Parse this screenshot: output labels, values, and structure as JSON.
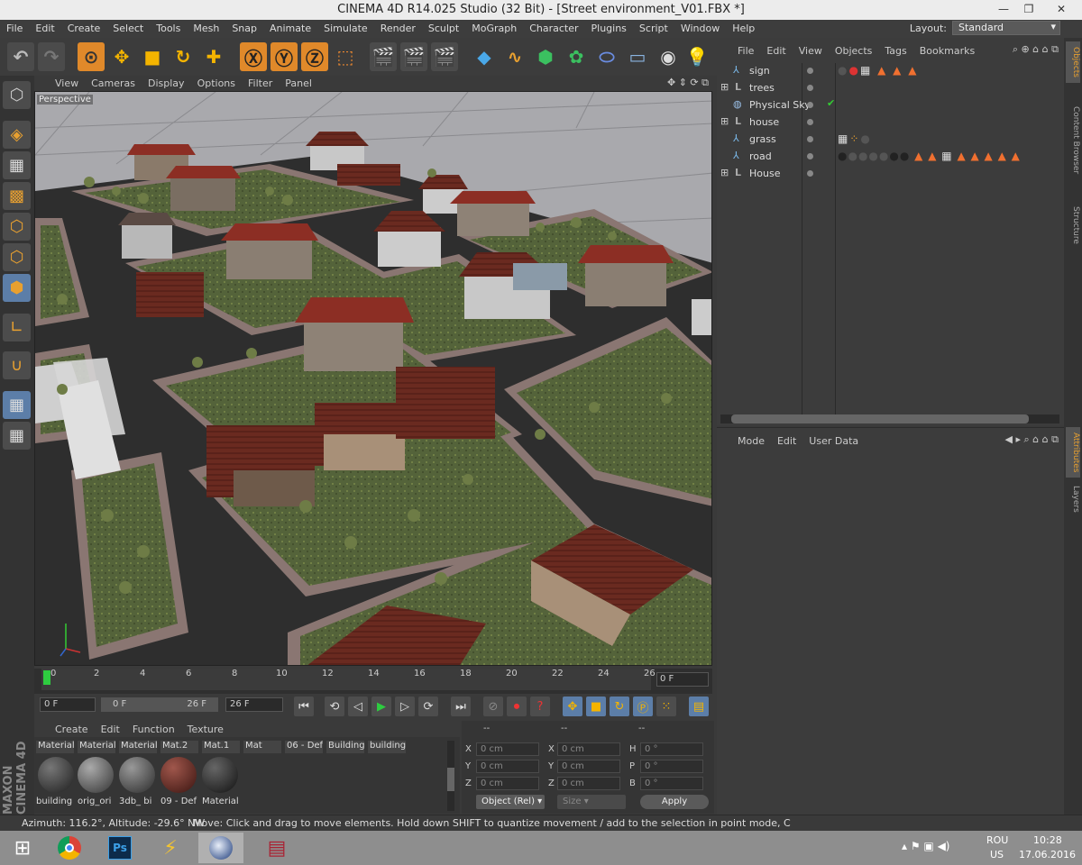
{
  "window": {
    "title": "CINEMA 4D R14.025 Studio (32 Bit) - [Street environment_V01.FBX *]",
    "minimize": "—",
    "restore": "❐",
    "close": "✕"
  },
  "menu": [
    "File",
    "Edit",
    "Create",
    "Select",
    "Tools",
    "Mesh",
    "Snap",
    "Animate",
    "Simulate",
    "Render",
    "Sculpt",
    "MoGraph",
    "Character",
    "Plugins",
    "Script",
    "Window",
    "Help"
  ],
  "layout": {
    "label": "Layout:",
    "value": "Standard"
  },
  "viewport": {
    "menu": [
      "View",
      "Cameras",
      "Display",
      "Options",
      "Filter",
      "Panel"
    ],
    "label": "Perspective"
  },
  "timeline": {
    "ticks": [
      "0",
      "2",
      "4",
      "6",
      "8",
      "10",
      "12",
      "14",
      "16",
      "18",
      "20",
      "22",
      "24",
      "26"
    ],
    "end_frame": "0 F"
  },
  "transport": {
    "current": "0 F",
    "range_start": "0 F",
    "range_end": "26 F",
    "max": "26 F"
  },
  "material_manager": {
    "menu": [
      "Create",
      "Edit",
      "Function",
      "Texture"
    ],
    "top_names": [
      "Material",
      "Material",
      "Material",
      "Mat.2",
      "Mat.1",
      "Mat",
      "06 - Def",
      "Building",
      "building"
    ],
    "materials": [
      {
        "label": "building",
        "color": "#333"
      },
      {
        "label": "orig_ori",
        "color": "#555"
      },
      {
        "label": "3db_ bi",
        "color": "#4a4a4a"
      },
      {
        "label": "09 - Def",
        "color": "#6a2e28"
      },
      {
        "label": "Material",
        "color": "#2a2a2a"
      }
    ]
  },
  "coordinates": {
    "headers": [
      "--",
      "--",
      "--"
    ],
    "rows": [
      {
        "a": "X",
        "av": "0 cm",
        "b": "X",
        "bv": "0 cm",
        "c": "H",
        "cv": "0 °"
      },
      {
        "a": "Y",
        "av": "0 cm",
        "b": "Y",
        "bv": "0 cm",
        "c": "P",
        "cv": "0 °"
      },
      {
        "a": "Z",
        "av": "0 cm",
        "b": "Z",
        "bv": "0 cm",
        "c": "B",
        "cv": "0 °"
      }
    ],
    "mode": "Object (Rel)",
    "size": "Size",
    "apply": "Apply"
  },
  "objects_panel": {
    "menu": [
      "File",
      "Edit",
      "View",
      "Objects",
      "Tags",
      "Bookmarks"
    ],
    "items": [
      {
        "name": "sign",
        "icon": "null-icon"
      },
      {
        "name": "trees",
        "icon": "layer-icon"
      },
      {
        "name": "Physical Sky",
        "icon": "sky-icon"
      },
      {
        "name": "house",
        "icon": "layer-icon"
      },
      {
        "name": "grass",
        "icon": "null-icon"
      },
      {
        "name": "road",
        "icon": "null-icon"
      },
      {
        "name": "House",
        "icon": "layer-icon"
      }
    ]
  },
  "attributes_panel": {
    "menu": [
      "Mode",
      "Edit",
      "User Data"
    ]
  },
  "right_tabs": [
    "Objects",
    "Content Browser",
    "Structure",
    "Attributes",
    "Layers"
  ],
  "status": {
    "camera": "Azimuth: 116.2°, Altitude: -29.6°  NW",
    "hint": "Move: Click and drag to move elements. Hold down SHIFT to quantize movement / add to the selection in point mode, C"
  },
  "side_logo": "MAXON CINEMA 4D",
  "taskbar": {
    "lang_top": "ROU",
    "lang_bottom": "US",
    "time": "10:28",
    "date": "17.06.2016"
  },
  "colors": {
    "accent": "#e0892a",
    "active_blue": "#5c7ea8",
    "roof": "#7a2a22",
    "road": "#2e2e2e",
    "grass": "#5a6b3a"
  }
}
